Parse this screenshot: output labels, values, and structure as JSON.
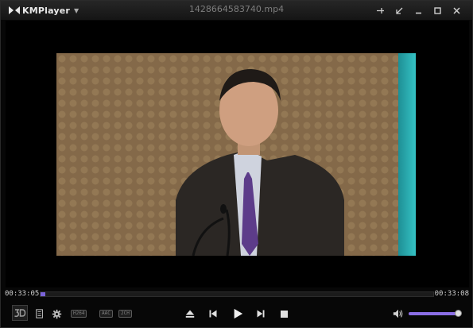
{
  "app": {
    "name": "KMPlayer"
  },
  "file": {
    "name": "1428664583740.mp4"
  },
  "window_buttons": [
    {
      "name": "pin-icon"
    },
    {
      "name": "mini-mode-icon"
    },
    {
      "name": "minimize-icon"
    },
    {
      "name": "maximize-icon"
    },
    {
      "name": "close-icon"
    }
  ],
  "playback": {
    "current_time": "00:33:05",
    "total_time": "00:33:08",
    "progress": 0.007
  },
  "badges": {
    "video_codec": "H264",
    "audio_codec": "AAC",
    "channels": "2CH"
  },
  "volume": {
    "level": 0.98
  },
  "colors": {
    "accent": "#7a63d8",
    "background": "#070707"
  }
}
